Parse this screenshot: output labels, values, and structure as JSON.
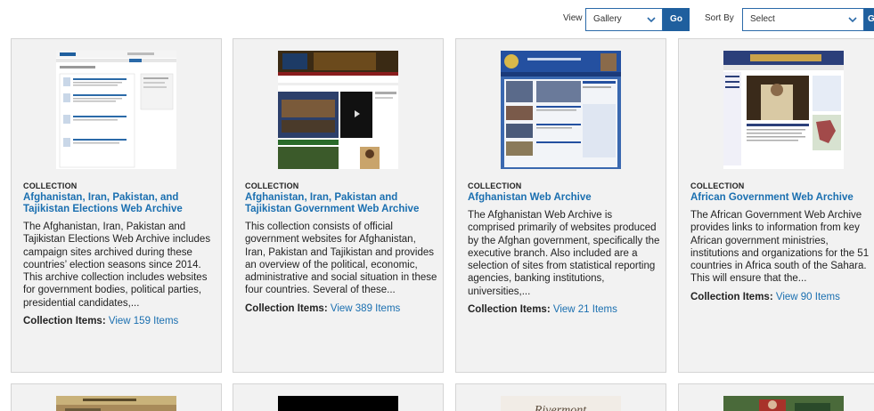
{
  "toolbar": {
    "view_label": "View",
    "view_value": "Gallery",
    "go_label": "Go",
    "sort_label": "Sort By",
    "sort_value": "Select",
    "sort_go_label": "G"
  },
  "cards": [
    {
      "kicker": "COLLECTION",
      "title": "Afghanistan, Iran, Pakistan, and Tajikistan Elections Web Archive",
      "description": "The Afghanistan, Iran, Pakistan and Tajikistan Elections Web Archive includes campaign sites archived during these countries’ election seasons since 2014. This archive collection includes websites for government bodies, political parties, presidential candidates,...",
      "items_label": "Collection Items:",
      "items_link": "View 159 Items"
    },
    {
      "kicker": "COLLECTION",
      "title": "Afghanistan, Iran, Pakistan and Tajikistan Government Web Archive",
      "description": "This collection consists of official government websites for Afghanistan, Iran, Pakistan and Tajikistan and provides an overview of the political, economic, administrative and social situation in these four countries. Several of these...",
      "items_label": "Collection Items:",
      "items_link": "View 389 Items"
    },
    {
      "kicker": "COLLECTION",
      "title": "Afghanistan Web Archive",
      "description": "The Afghanistan Web Archive is comprised primarily of websites produced by the Afghan government, specifically the executive branch. Also included are a selection of sites from statistical reporting agencies, banking institutions, universities,...",
      "items_label": "Collection Items:",
      "items_link": "View 21 Items"
    },
    {
      "kicker": "COLLECTION",
      "title": "African Government Web Archive",
      "description": "The African Government Web Archive provides links to information from key African government ministries, institutions and organizations for the 51 countries in Africa south of the Sahara. This will ensure that the...",
      "items_label": "Collection Items:",
      "items_link": "View 90 Items"
    }
  ],
  "thumb_texts": {
    "riverment": "Rivermont"
  },
  "colors": {
    "accent": "#1f5f9e",
    "link": "#1a6fb0",
    "card_bg": "#f2f2f2"
  }
}
